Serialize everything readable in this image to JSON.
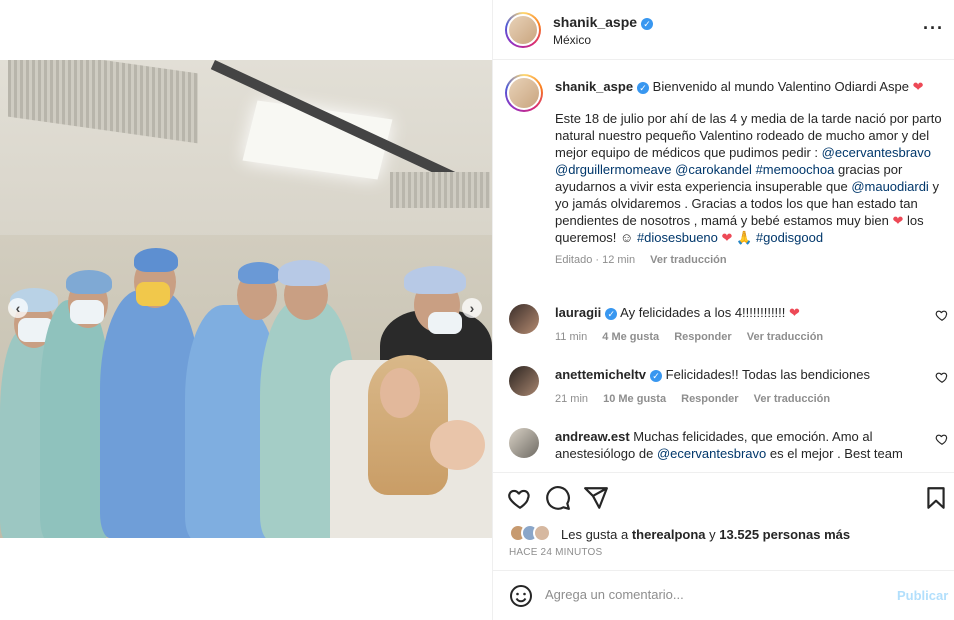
{
  "post": {
    "username": "shanik_aspe",
    "location": "México",
    "verified": true
  },
  "caption": {
    "username": "shanik_aspe",
    "headline": "Bienvenido al mundo Valentino Odiardi Aspe",
    "body_1": "Este 18 de julio por ahí de las 4 y media de la tarde nació por parto natural nuestro pequeño Valentino rodeado de mucho amor y del mejor equipo de médicos que pudimos pedir :",
    "mention_1": "@ecervantesbravo",
    "mention_2": "@drguillermomeave",
    "mention_3": "@carokandel",
    "mention_4": "#memoochoa",
    "body_2": "gracias por ayudarnos a vivir esta experiencia insuperable que",
    "mention_5": "@mauodiardi",
    "body_3": "y yo jamás olvidaremos . Gracias a todos los que han estado tan pendientes de nosotros , mamá y bebé estamos muy bien",
    "body_4": "los queremos! ☺",
    "hashtag_1": "#diosesbueno",
    "hashtag_2": "#godisgood",
    "edited": "Editado · 12 min",
    "see_translation": "Ver traducción"
  },
  "comments": [
    {
      "username": "lauragii",
      "text": "Ay felicidades a los 4!!!!!!!!!!!!",
      "time": "11 min",
      "likes": "4 Me gusta",
      "reply": "Responder",
      "translate": "Ver traducción"
    },
    {
      "username": "anettemicheltv",
      "text": "Felicidades!! Todas las bendiciones",
      "time": "21 min",
      "likes": "10 Me gusta",
      "reply": "Responder",
      "translate": "Ver traducción"
    },
    {
      "username": "andreaw.est",
      "text_1": "Muchas felicidades, que emoción. Amo al anestesiólogo de",
      "mention": "@ecervantesbravo",
      "text_2": "es el mejor . Best team"
    }
  ],
  "likes": {
    "prefix": "Les gusta a",
    "user": "therealpona",
    "connector": "y",
    "others": "13.525 personas más",
    "time_ago": "HACE 24 MINUTOS"
  },
  "add_comment": {
    "placeholder": "Agrega un comentario...",
    "publish": "Publicar"
  },
  "icons": [
    "heart-icon",
    "comment-icon",
    "share-icon",
    "bookmark-icon",
    "emoji-icon",
    "more-icon",
    "verified-icon"
  ],
  "colors": {
    "link": "#00376b",
    "heart": "#ed4956",
    "verified": "#3897f0",
    "publish_disabled": "#b2dffc",
    "muted": "#8e8e8e"
  }
}
